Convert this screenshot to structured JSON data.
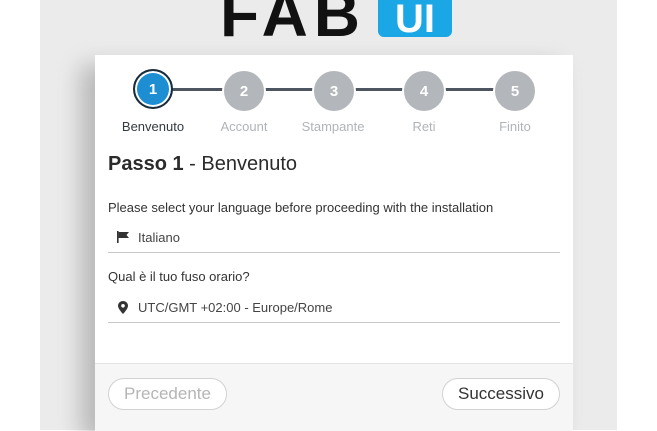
{
  "logo": {
    "text": "FAB",
    "badge": "UI"
  },
  "steps": [
    {
      "number": "1",
      "label": "Benvenuto",
      "active": true
    },
    {
      "number": "2",
      "label": "Account",
      "active": false
    },
    {
      "number": "3",
      "label": "Stampante",
      "active": false
    },
    {
      "number": "4",
      "label": "Reti",
      "active": false
    },
    {
      "number": "5",
      "label": "Finito",
      "active": false
    }
  ],
  "title": {
    "step": "Passo 1",
    "separator": " - ",
    "name": "Benvenuto"
  },
  "language": {
    "prompt": "Please select your language before proceeding with the installation",
    "value": "Italiano",
    "icon": "flag-icon"
  },
  "timezone": {
    "prompt": "Qual è il tuo fuso orario?",
    "value": "UTC/GMT +02:00 - Europe/Rome",
    "icon": "map-marker-icon"
  },
  "buttons": {
    "prev_label": "Precedente",
    "next_label": "Successivo"
  },
  "colors": {
    "accent": "#1e8ed2",
    "inactive_step": "#b3b7bb",
    "logo_blue": "#1ba6e6"
  }
}
